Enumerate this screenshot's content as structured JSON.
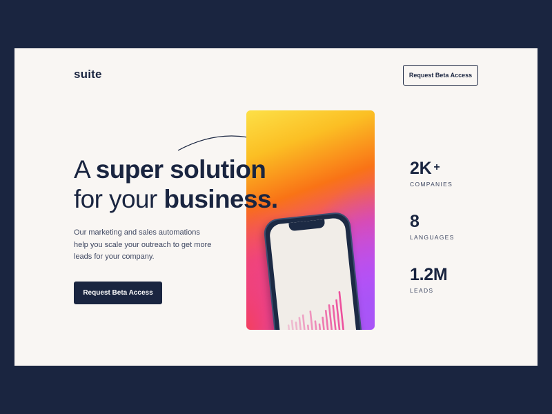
{
  "brand": {
    "logo": "suite"
  },
  "header": {
    "button_label": "Request Beta Access"
  },
  "hero": {
    "headline_light_1": "A ",
    "headline_bold_1": "super solution",
    "headline_light_2": "for your ",
    "headline_bold_2": "business.",
    "description": "Our marketing and sales automations help you scale your outreach to get more leads for your company.",
    "cta_label": "Request Beta Access"
  },
  "stats": [
    {
      "value": "2K",
      "suffix": "+",
      "label": "COMPANIES"
    },
    {
      "value": "8",
      "suffix": "",
      "label": "LANGUAGES"
    },
    {
      "value": "1.2M",
      "suffix": "",
      "label": "LEADS"
    }
  ],
  "colors": {
    "background": "#1a2540",
    "card": "#f9f6f3",
    "text": "#1a2540",
    "bar_pink": "#ec4899"
  },
  "phone_chart": {
    "bar_values": [
      0.35,
      0.45,
      0.4,
      0.5,
      0.55,
      0.3,
      0.62,
      0.38,
      0.3,
      0.45,
      0.6,
      0.72,
      0.7,
      0.82,
      1.0
    ]
  }
}
